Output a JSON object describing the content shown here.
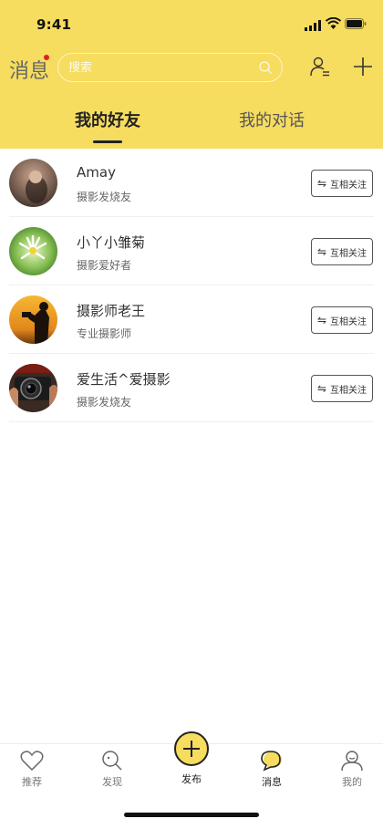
{
  "status_bar": {
    "time": "9:41"
  },
  "header": {
    "title": "消息",
    "search_placeholder": "搜索",
    "tabs": [
      {
        "label": "我的好友",
        "active": true
      },
      {
        "label": "我的对话",
        "active": false
      }
    ]
  },
  "friends": [
    {
      "name": "Amay",
      "description": "摄影发烧友",
      "button": "互相关注"
    },
    {
      "name": "小丫小雏菊",
      "description": "摄影爱好者",
      "button": "互相关注"
    },
    {
      "name": "摄影师老王",
      "description": "专业摄影师",
      "button": "互相关注"
    },
    {
      "name": "爱生活^爱摄影",
      "description": "摄影发烧友",
      "button": "互相关注"
    }
  ],
  "bottom_nav": {
    "items": [
      {
        "label": "推荐",
        "icon": "heart-icon"
      },
      {
        "label": "发现",
        "icon": "search-icon"
      },
      {
        "label": "发布",
        "icon": "plus-icon"
      },
      {
        "label": "消息",
        "icon": "chat-icon",
        "active": true
      },
      {
        "label": "我的",
        "icon": "profile-icon"
      }
    ]
  },
  "colors": {
    "accent": "#f6dc5f",
    "badge": "#e02020"
  }
}
